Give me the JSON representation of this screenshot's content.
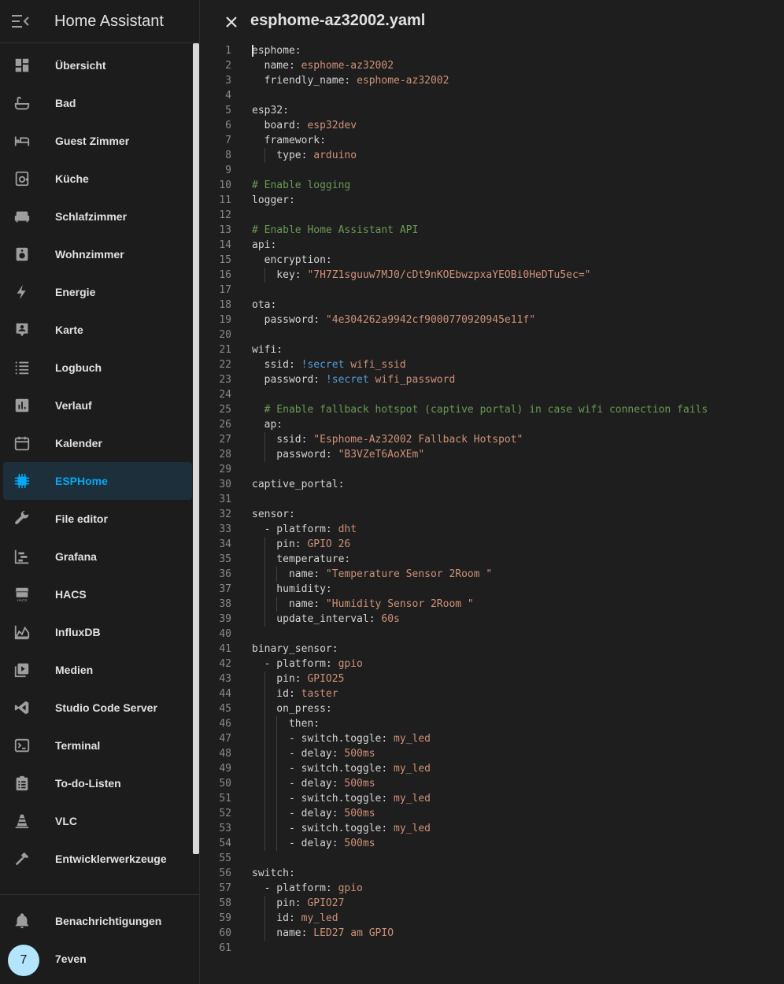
{
  "sidebar": {
    "title": "Home Assistant",
    "items": [
      {
        "label": "Übersicht",
        "icon": "dashboard-icon"
      },
      {
        "label": "Bad",
        "icon": "bathtub-icon"
      },
      {
        "label": "Guest Zimmer",
        "icon": "bed-icon"
      },
      {
        "label": "Küche",
        "icon": "stove-icon"
      },
      {
        "label": "Schlafzimmer",
        "icon": "bed-sofa-icon"
      },
      {
        "label": "Wohnzimmer",
        "icon": "speaker-icon"
      },
      {
        "label": "Energie",
        "icon": "lightning-icon"
      },
      {
        "label": "Karte",
        "icon": "account-box-icon"
      },
      {
        "label": "Logbuch",
        "icon": "list-icon"
      },
      {
        "label": "Verlauf",
        "icon": "chart-box-icon"
      },
      {
        "label": "Kalender",
        "icon": "calendar-icon"
      },
      {
        "label": "ESPHome",
        "icon": "chip-icon",
        "active": true
      },
      {
        "label": "File editor",
        "icon": "wrench-icon"
      },
      {
        "label": "Grafana",
        "icon": "chart-gantt-icon"
      },
      {
        "label": "HACS",
        "icon": "hacs-store-icon"
      },
      {
        "label": "InfluxDB",
        "icon": "chart-areaspline-icon"
      },
      {
        "label": "Medien",
        "icon": "play-box-multiple-icon"
      },
      {
        "label": "Studio Code Server",
        "icon": "vscode-icon"
      },
      {
        "label": "Terminal",
        "icon": "console-icon"
      },
      {
        "label": "To-do-Listen",
        "icon": "clipboard-list-icon"
      },
      {
        "label": "VLC",
        "icon": "traffic-cone-icon"
      },
      {
        "label": "Entwicklerwerkzeuge",
        "icon": "hammer-icon"
      }
    ],
    "notifications_label": "Benachrichtigungen",
    "user": {
      "initial": "7",
      "name": "7even"
    }
  },
  "editor": {
    "filename": "esphome-az32002.yaml",
    "lines": [
      [
        [
          "k",
          "esphome:"
        ]
      ],
      [
        [
          "k",
          "  name: "
        ],
        [
          "v",
          "esphome-az32002"
        ]
      ],
      [
        [
          "k",
          "  friendly_name: "
        ],
        [
          "v",
          "esphome-az32002"
        ]
      ],
      [],
      [
        [
          "k",
          "esp32:"
        ]
      ],
      [
        [
          "k",
          "  board: "
        ],
        [
          "v",
          "esp32dev"
        ]
      ],
      [
        [
          "k",
          "  framework:"
        ]
      ],
      [
        [
          "k",
          "    type: "
        ],
        [
          "v",
          "arduino"
        ]
      ],
      [],
      [
        [
          "c",
          "# Enable logging"
        ]
      ],
      [
        [
          "k",
          "logger:"
        ]
      ],
      [],
      [
        [
          "c",
          "# Enable Home Assistant API"
        ]
      ],
      [
        [
          "k",
          "api:"
        ]
      ],
      [
        [
          "k",
          "  encryption:"
        ]
      ],
      [
        [
          "k",
          "    key: "
        ],
        [
          "v",
          "\"7H7Z1sguuw7MJ0/cDt9nKOEbwzpxaYEOBi0HeDTu5ec=\""
        ]
      ],
      [],
      [
        [
          "k",
          "ota:"
        ]
      ],
      [
        [
          "k",
          "  password: "
        ],
        [
          "v",
          "\"4e304262a9942cf9000770920945e11f\""
        ]
      ],
      [],
      [
        [
          "k",
          "wifi:"
        ]
      ],
      [
        [
          "k",
          "  ssid: "
        ],
        [
          "t",
          "!secret"
        ],
        [
          "v",
          " wifi_ssid"
        ]
      ],
      [
        [
          "k",
          "  password: "
        ],
        [
          "t",
          "!secret"
        ],
        [
          "v",
          " wifi_password"
        ]
      ],
      [],
      [
        [
          "c",
          "  # Enable fallback hotspot (captive portal) in case wifi connection fails"
        ]
      ],
      [
        [
          "k",
          "  ap:"
        ]
      ],
      [
        [
          "k",
          "    ssid: "
        ],
        [
          "v",
          "\"Esphome-Az32002 Fallback Hotspot\""
        ]
      ],
      [
        [
          "k",
          "    password: "
        ],
        [
          "v",
          "\"B3VZeT6AoXEm\""
        ]
      ],
      [],
      [
        [
          "k",
          "captive_portal:"
        ]
      ],
      [],
      [
        [
          "k",
          "sensor:"
        ]
      ],
      [
        [
          "k",
          "  - platform: "
        ],
        [
          "v",
          "dht"
        ]
      ],
      [
        [
          "k",
          "    pin: "
        ],
        [
          "v",
          "GPIO 26"
        ]
      ],
      [
        [
          "k",
          "    temperature:"
        ]
      ],
      [
        [
          "k",
          "      name: "
        ],
        [
          "v",
          "\"Temperature Sensor 2Room \""
        ]
      ],
      [
        [
          "k",
          "    humidity:"
        ]
      ],
      [
        [
          "k",
          "      name: "
        ],
        [
          "v",
          "\"Humidity Sensor 2Room \""
        ]
      ],
      [
        [
          "k",
          "    update_interval: "
        ],
        [
          "v",
          "60s"
        ]
      ],
      [],
      [
        [
          "k",
          "binary_sensor:"
        ]
      ],
      [
        [
          "k",
          "  - platform: "
        ],
        [
          "v",
          "gpio"
        ]
      ],
      [
        [
          "k",
          "    pin: "
        ],
        [
          "v",
          "GPIO25"
        ]
      ],
      [
        [
          "k",
          "    id: "
        ],
        [
          "v",
          "taster"
        ]
      ],
      [
        [
          "k",
          "    on_press:"
        ]
      ],
      [
        [
          "k",
          "      then:"
        ]
      ],
      [
        [
          "k",
          "      - switch.toggle: "
        ],
        [
          "v",
          "my_led"
        ]
      ],
      [
        [
          "k",
          "      - delay: "
        ],
        [
          "v",
          "500ms"
        ]
      ],
      [
        [
          "k",
          "      - switch.toggle: "
        ],
        [
          "v",
          "my_led"
        ]
      ],
      [
        [
          "k",
          "      - delay: "
        ],
        [
          "v",
          "500ms"
        ]
      ],
      [
        [
          "k",
          "      - switch.toggle: "
        ],
        [
          "v",
          "my_led"
        ]
      ],
      [
        [
          "k",
          "      - delay: "
        ],
        [
          "v",
          "500ms"
        ]
      ],
      [
        [
          "k",
          "      - switch.toggle: "
        ],
        [
          "v",
          "my_led"
        ]
      ],
      [
        [
          "k",
          "      - delay: "
        ],
        [
          "v",
          "500ms"
        ]
      ],
      [],
      [
        [
          "k",
          "switch:"
        ]
      ],
      [
        [
          "k",
          "  - platform: "
        ],
        [
          "v",
          "gpio"
        ]
      ],
      [
        [
          "k",
          "    pin: "
        ],
        [
          "v",
          "GPIO27"
        ]
      ],
      [
        [
          "k",
          "    id: "
        ],
        [
          "v",
          "my_led"
        ]
      ],
      [
        [
          "k",
          "    name: "
        ],
        [
          "v",
          "LED27 am GPIO"
        ]
      ],
      []
    ]
  }
}
